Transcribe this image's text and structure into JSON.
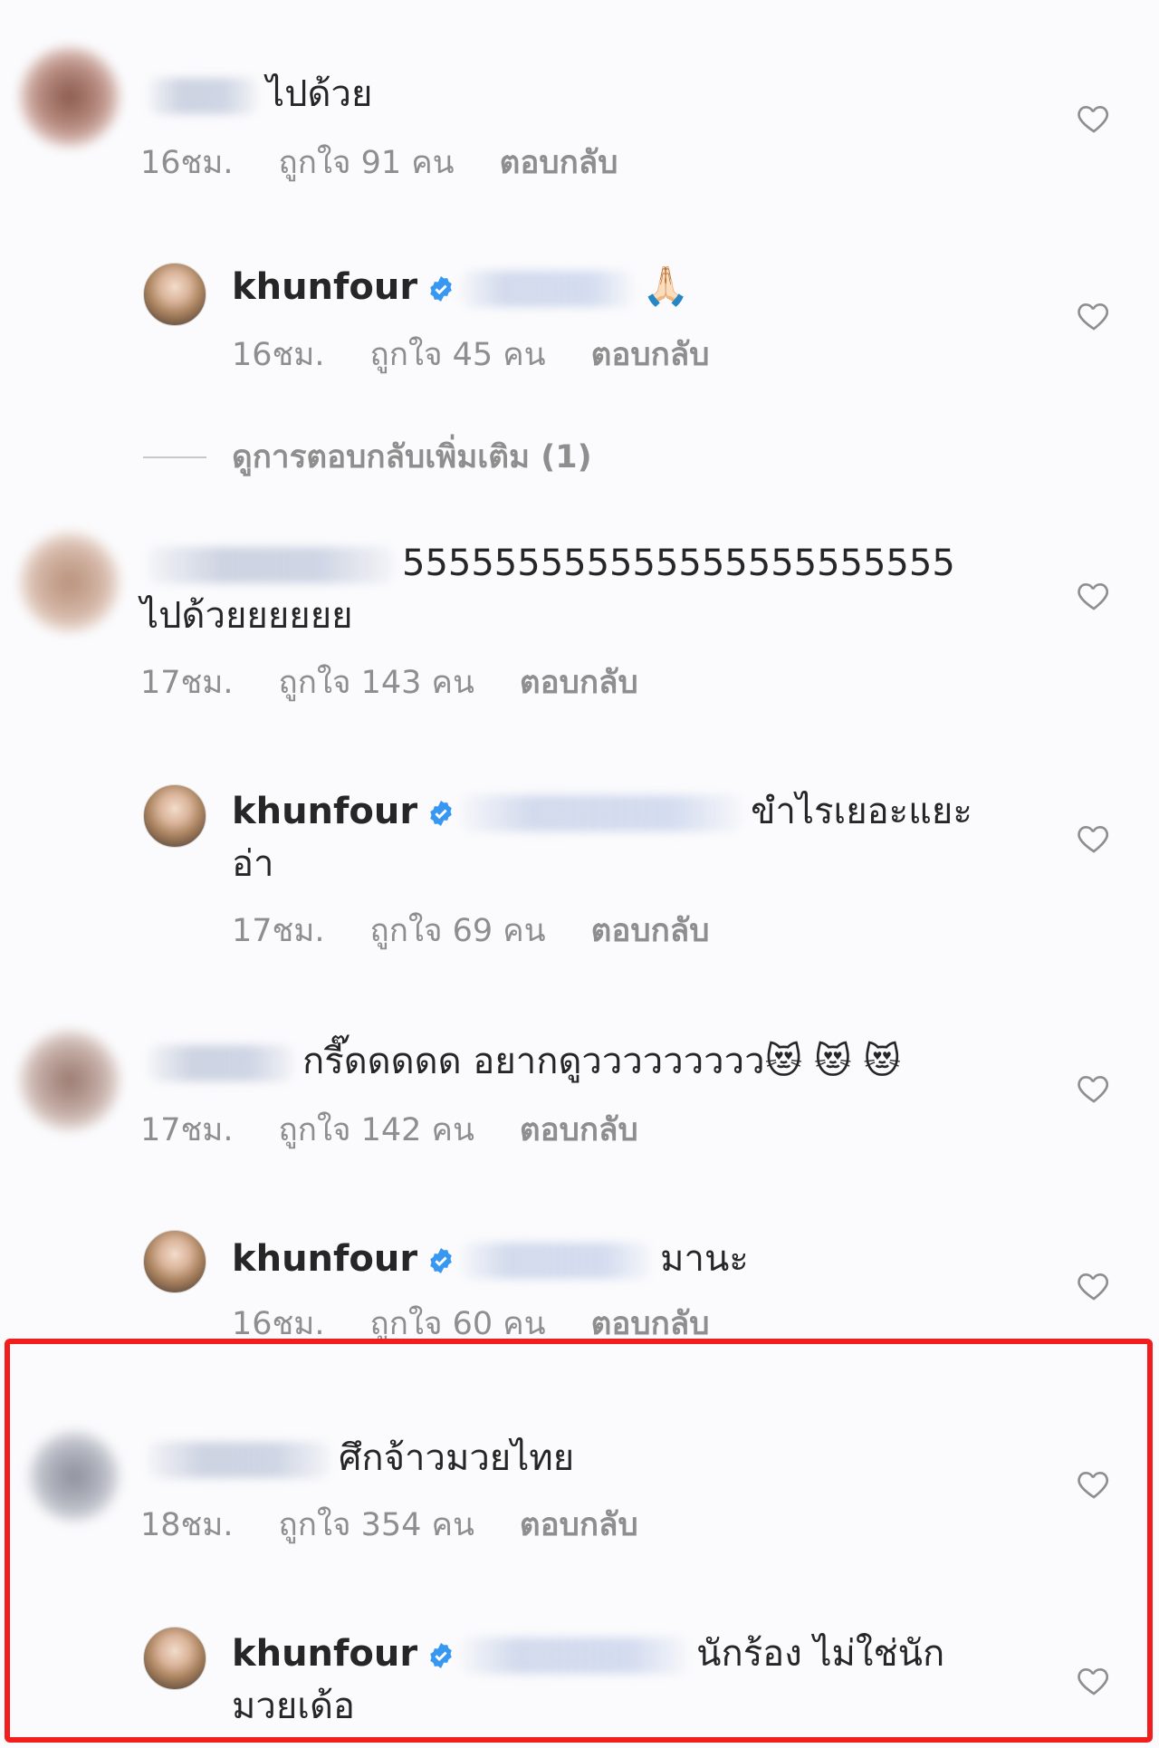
{
  "comments": [
    {
      "text": "ไปด้วย",
      "time": "16ชม.",
      "likes": "ถูกใจ 91 คน",
      "reply": "ตอบกลับ"
    },
    {
      "author": "khunfour",
      "text": "🙏🏻",
      "time": "16ชม.",
      "likes": "ถูกใจ 45 คน",
      "reply": "ตอบกลับ"
    },
    {
      "text_line1": "555555555555555555555555",
      "text_line2": "ไปด้วยยยยยย",
      "time": "17ชม.",
      "likes": "ถูกใจ 143 คน",
      "reply": "ตอบกลับ"
    },
    {
      "author": "khunfour",
      "text_line1": "ขำไรเยอะแยะ",
      "text_line2": "อ่า",
      "time": "17ชม.",
      "likes": "ถูกใจ 69 คน",
      "reply": "ตอบกลับ"
    },
    {
      "text": "กรี๊ดดดดด อยากดูววววววววว😻 😻 😻",
      "time": "17ชม.",
      "likes": "ถูกใจ 142 คน",
      "reply": "ตอบกลับ"
    },
    {
      "author": "khunfour",
      "text": "มานะ",
      "time": "16ชม.",
      "likes": "ถูกใจ 60 คน",
      "reply": "ตอบกลับ"
    },
    {
      "text": "ศึกจ้าวมวยไทย",
      "time": "18ชม.",
      "likes": "ถูกใจ 354 คน",
      "reply": "ตอบกลับ"
    },
    {
      "author": "khunfour",
      "text_line1": "นักร้อง ไม่ใช่นัก",
      "text_line2": "มวยเด้อ"
    }
  ],
  "view_more_replies": "ดูการตอบกลับเพิ่มเติม (1)",
  "colors": {
    "verified": "#3897f0",
    "highlight": "#f21d1d",
    "meta": "#8e8e8e"
  },
  "icons": {
    "like": "heart-outline-icon",
    "verified": "verified-badge-icon"
  }
}
